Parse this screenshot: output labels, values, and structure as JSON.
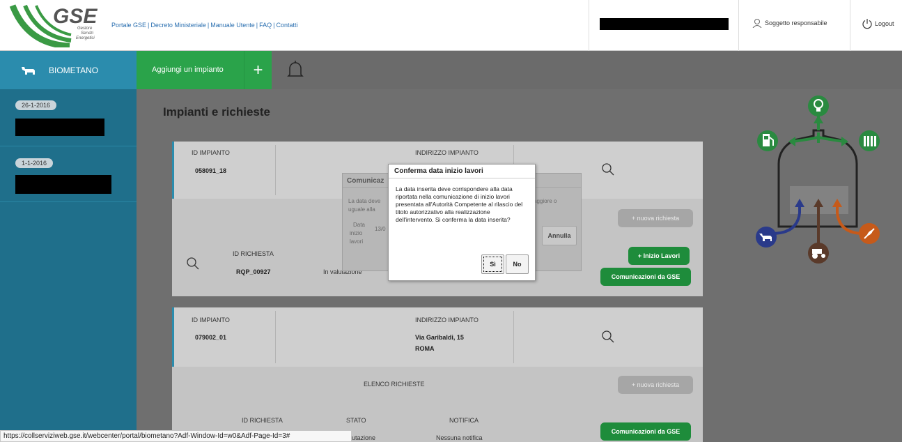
{
  "header": {
    "logo_text": "GSE",
    "logo_sub": [
      "Gestore",
      "Servizi",
      "Energetici"
    ],
    "links": [
      "Portale GSE",
      "Decreto Ministeriale",
      "Manuale Utente",
      "FAQ",
      "Contatti"
    ],
    "user_label": "Soggetto responsabile",
    "logout_label": "Logout"
  },
  "navbar": {
    "section_label": "BIOMETANO",
    "add_label": "Aggiungi un impianto",
    "add_plus": "+"
  },
  "sidebar": {
    "items": [
      {
        "date": "26-1-2016"
      },
      {
        "date": "1-1-2016"
      }
    ]
  },
  "main": {
    "title": "Impianti e richieste",
    "cards": [
      {
        "id_label": "ID IMPIANTO",
        "id_value": "058091_18",
        "addr_label": "INDIRIZZO IMPIANTO",
        "new_request": "+ nuova richiesta",
        "req_id_label": "ID RICHIESTA",
        "req_id": "RQP_00927",
        "req_state": "In valutazione",
        "inizio_lavori": "+ Inizio Lavori",
        "comunicazioni": "Comunicazioni da GSE"
      },
      {
        "id_label": "ID IMPIANTO",
        "id_value": "079002_01",
        "addr_label": "INDIRIZZO IMPIANTO",
        "addr_line1": "Via Garibaldi, 15",
        "addr_line2": "ROMA",
        "list_label": "ELENCO RICHIESTE",
        "new_request": "+ nuova richiesta",
        "req_id_label": "ID RICHIESTA",
        "stato_label": "STATO",
        "notifica_label": "NOTIFICA",
        "req_state": "utazione",
        "notifica_value": "Nessuna notifica",
        "comunicazioni": "Comunicazioni da GSE"
      }
    ]
  },
  "back_dialog": {
    "title": "Comunicaz",
    "text1": "La data deve",
    "text2": "uguale alla",
    "text3": "aggiore o",
    "field_label1": "Data",
    "field_label2": "inizio",
    "field_label3": "lavori",
    "field_value": "13/0",
    "cancel": "Annulla"
  },
  "dialog": {
    "title": "Conferma data inizio lavori",
    "message": "La data inserita deve corrispondere alla data riportata nella comunicazione di inizio lavori presentata all'Autorità Competente al rilascio del titolo autorizzativo alla realizzazione dell'intervento. Si conferma la data inserita?",
    "yes": "Sì",
    "no": "No"
  },
  "statusbar": {
    "url": "https://collserviziweb.gse.it/webcenter/portal/biometano?Adf-Window-Id=w0&Adf-Page-Id=3#"
  },
  "icons": [
    "gse-logo",
    "user-icon",
    "power-icon",
    "cow-icon",
    "plus-icon",
    "bell-icon",
    "magnifier-icon",
    "bulb-icon",
    "fuel-pump-icon",
    "radiator-icon",
    "tractor-icon",
    "leaf-icon"
  ],
  "colors": {
    "sidebar": "#1f6f8b",
    "section_tab": "#2b8cad",
    "green": "#2aa34a",
    "green_button": "#1e8c3b"
  }
}
